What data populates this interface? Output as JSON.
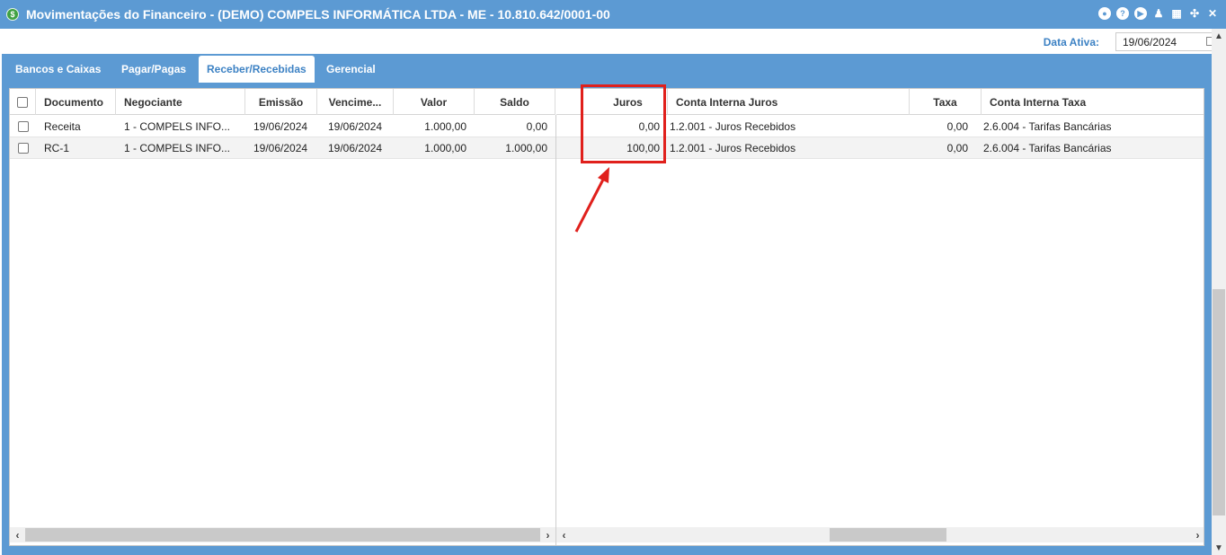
{
  "window": {
    "title": "Movimentações do Financeiro - (DEMO) COMPELS INFORMÁTICA LTDA - ME - 10.810.642/0001-00",
    "app_icon": "$",
    "controls": [
      "record-icon",
      "help-icon",
      "play-icon",
      "bell-icon",
      "calendar-icon",
      "collapse-icon",
      "close-icon"
    ]
  },
  "date_bar": {
    "label": "Data Ativa:",
    "value": "19/06/2024"
  },
  "tabs": [
    {
      "label": "Bancos e Caixas",
      "active": false
    },
    {
      "label": "Pagar/Pagas",
      "active": false
    },
    {
      "label": "Receber/Recebidas",
      "active": true
    },
    {
      "label": "Gerencial",
      "active": false
    }
  ],
  "grid": {
    "left_columns": [
      "Documento",
      "Negociante",
      "Emissão",
      "Vencime...",
      "Valor",
      "Saldo"
    ],
    "right_columns": [
      "Juros",
      "Conta Interna Juros",
      "Taxa",
      "Conta Interna Taxa"
    ],
    "rows": [
      {
        "documento": "Receita",
        "negociante": "1 - COMPELS INFO...",
        "emissao": "19/06/2024",
        "vencimento": "19/06/2024",
        "valor": "1.000,00",
        "saldo": "0,00",
        "juros": "0,00",
        "conta_juros": "1.2.001 - Juros Recebidos",
        "taxa": "0,00",
        "conta_taxa": "2.6.004 - Tarifas Bancárias"
      },
      {
        "documento": "RC-1",
        "negociante": "1 - COMPELS INFO...",
        "emissao": "19/06/2024",
        "vencimento": "19/06/2024",
        "valor": "1.000,00",
        "saldo": "1.000,00",
        "juros": "100,00",
        "conta_juros": "1.2.001 - Juros Recebidos",
        "taxa": "0,00",
        "conta_taxa": "2.6.004 - Tarifas Bancárias"
      }
    ]
  },
  "colors": {
    "accent": "#5c9ad3",
    "label_blue": "#3d82c4",
    "annotation_red": "#e0201c"
  }
}
